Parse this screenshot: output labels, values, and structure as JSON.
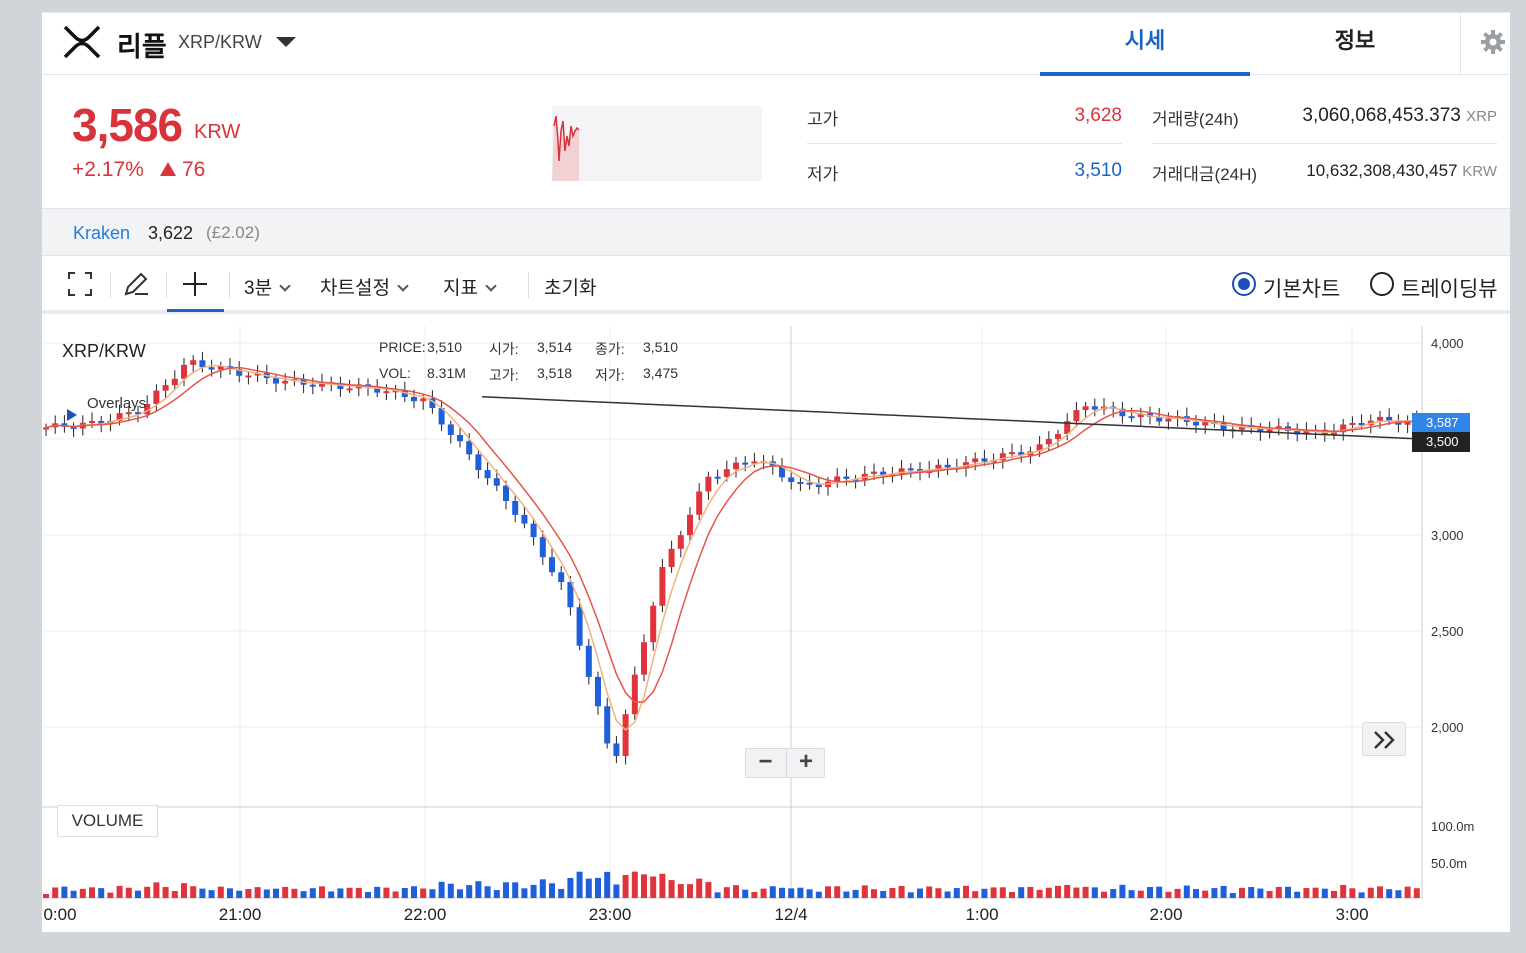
{
  "header": {
    "coin_name": "리플",
    "pair": "XRP/KRW",
    "tabs": [
      {
        "label": "시세",
        "active": true
      },
      {
        "label": "정보",
        "active": false
      }
    ]
  },
  "summary": {
    "price": "3,586",
    "price_unit": "KRW",
    "change_pct": "+2.17%",
    "change_amt": "76",
    "high_label": "고가",
    "high": "3,628",
    "low_label": "저가",
    "low": "3,510",
    "volume_label": "거래량(24h)",
    "volume": "3,060,068,453.373",
    "volume_unit": "XRP",
    "value_label": "거래대금(24H)",
    "value": "10,632,308,430,457",
    "value_unit": "KRW"
  },
  "exchange": {
    "name": "Kraken",
    "price": "3,622",
    "converted": "(£2.02)"
  },
  "toolbar": {
    "interval": "3분",
    "chart_settings": "차트설정",
    "indicators": "지표",
    "reset": "초기화",
    "radio_basic": "기본차트",
    "radio_trading": "트레이딩뷰"
  },
  "chart": {
    "pair_label": "XRP/KRW",
    "info": {
      "price_label": "PRICE:",
      "price": "3,510",
      "open_label": "시가:",
      "open": "3,514",
      "close_label": "종가:",
      "close": "3,510",
      "vol_label": "VOL:",
      "vol": "8.31M",
      "high_label": "고가:",
      "high": "3,518",
      "low_label": "저가:",
      "low": "3,475"
    },
    "overlays_label": "Overlays",
    "volume_label": "VOLUME",
    "last_price_tag": "3,587",
    "ma_tag": "3,500",
    "x_ticks": [
      "0:00",
      "21:00",
      "22:00",
      "23:00",
      "12/4",
      "1:00",
      "2:00",
      "3:00"
    ],
    "y_ticks": [
      "4,000",
      "3,000",
      "2,500",
      "2,000"
    ],
    "vol_ticks": [
      "100.0m",
      "50.0m"
    ],
    "colors": {
      "up": "#e0333c",
      "down": "#1f5fdc",
      "ma_short": "#e6554a",
      "ma_mid": "#f0b37e",
      "ma_long": "#333333",
      "accent": "#1c63c9"
    }
  },
  "chart_data": {
    "type": "candlestick",
    "x_labels": [
      "0:00",
      "21:00",
      "22:00",
      "23:00",
      "12/4",
      "1:00",
      "2:00",
      "3:00"
    ],
    "y_ticks": [
      4000,
      3000,
      2500,
      2000
    ],
    "volume_ticks": [
      "100.0m",
      "50.0m"
    ],
    "close_approx": [
      3560,
      3580,
      3650,
      3900,
      3850,
      3800,
      3780,
      3760,
      3700,
      3400,
      3100,
      2700,
      1800,
      2800,
      3300,
      3400,
      3250,
      3300,
      3330,
      3350,
      3400,
      3450,
      3680,
      3620,
      3600,
      3560,
      3550,
      3530,
      3600,
      3587
    ],
    "last_price": 3587,
    "long_ma_last": 3500
  }
}
